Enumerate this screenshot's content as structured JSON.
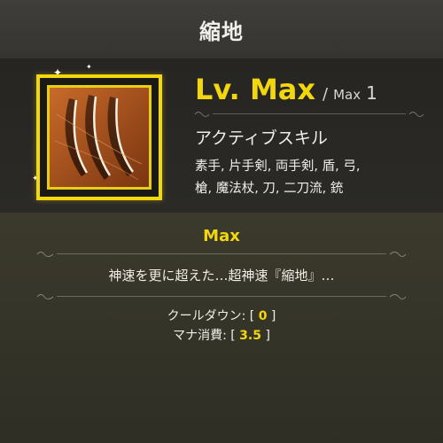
{
  "title": "縮地",
  "level": {
    "current": "Lv. Max",
    "separator": "/",
    "max_label": "Max",
    "max_value": "1"
  },
  "skill_type": "アクティブスキル",
  "weapons_line1": "素手, 片手剣, 両手剣, 盾, 弓,",
  "weapons_line2": "槍, 魔法杖, 刀, 二刀流, 銃",
  "tier": "Max",
  "description": "神速を更に超えた…超神速『縮地』…",
  "stats": {
    "cooldown_label": "クールダウン: [",
    "cooldown_value": "0",
    "cooldown_close": "]",
    "mana_label": "マナ消費: [",
    "mana_value": "3.5",
    "mana_close": "]"
  },
  "colors": {
    "accent": "#f3d70e",
    "frame": "#f3d90b",
    "text": "#f0eee8"
  },
  "icon": "claw-slash-icon"
}
